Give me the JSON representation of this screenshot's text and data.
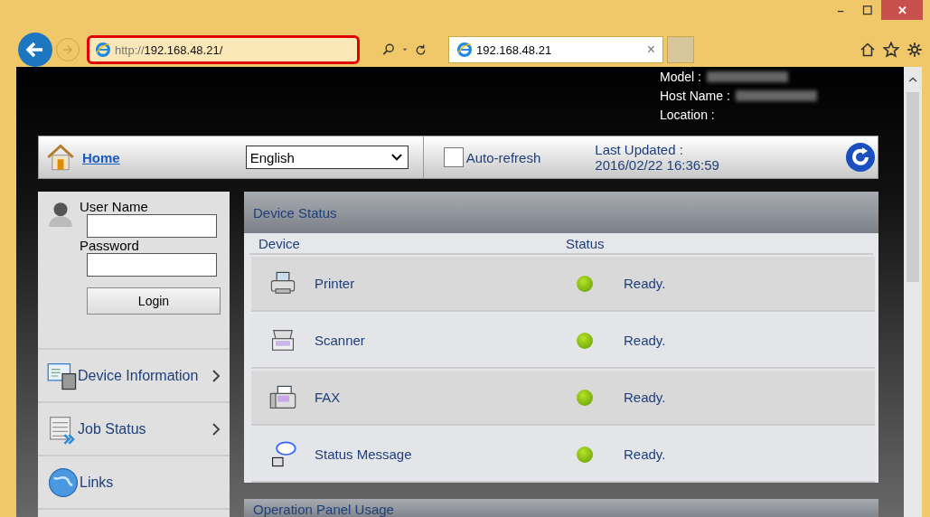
{
  "window": {
    "minimize": "–",
    "maximize": "☐",
    "close": "✕"
  },
  "address_bar": {
    "url_prefix": "http://",
    "url_host": "192.168.48.21/"
  },
  "tabs": [
    {
      "label": "192.168.48.21",
      "close": "×",
      "selected": true
    }
  ],
  "device_header": {
    "fields": [
      {
        "label": "Model :"
      },
      {
        "label": "Host Name :"
      },
      {
        "label": "Location :"
      }
    ]
  },
  "nav_bar": {
    "home": "Home",
    "language": "English",
    "auto_refresh": {
      "label": "Auto-refresh",
      "checked": false
    },
    "last_updated_label": "Last Updated :",
    "last_updated": "2016/02/22 16:36:59"
  },
  "login": {
    "user_name_label": "User Name",
    "password_label": "Password",
    "button": "Login"
  },
  "sidebar": {
    "items": [
      {
        "label": "Device Information",
        "kind": "device",
        "expandable": true
      },
      {
        "label": "Job Status",
        "kind": "jobs",
        "expandable": true
      },
      {
        "label": "Links",
        "kind": "links",
        "expandable": false
      }
    ]
  },
  "device_status": {
    "title": "Device Status",
    "columns": [
      "Device",
      "Status"
    ],
    "rows": [
      {
        "kind": "printer",
        "device": "Printer",
        "status": "Ready."
      },
      {
        "kind": "scanner",
        "device": "Scanner",
        "status": "Ready."
      },
      {
        "kind": "fax",
        "device": "FAX",
        "status": "Ready."
      },
      {
        "kind": "message",
        "device": "Status Message",
        "status": "Ready."
      }
    ]
  },
  "next_section": {
    "title": "Operation Panel Usage"
  }
}
